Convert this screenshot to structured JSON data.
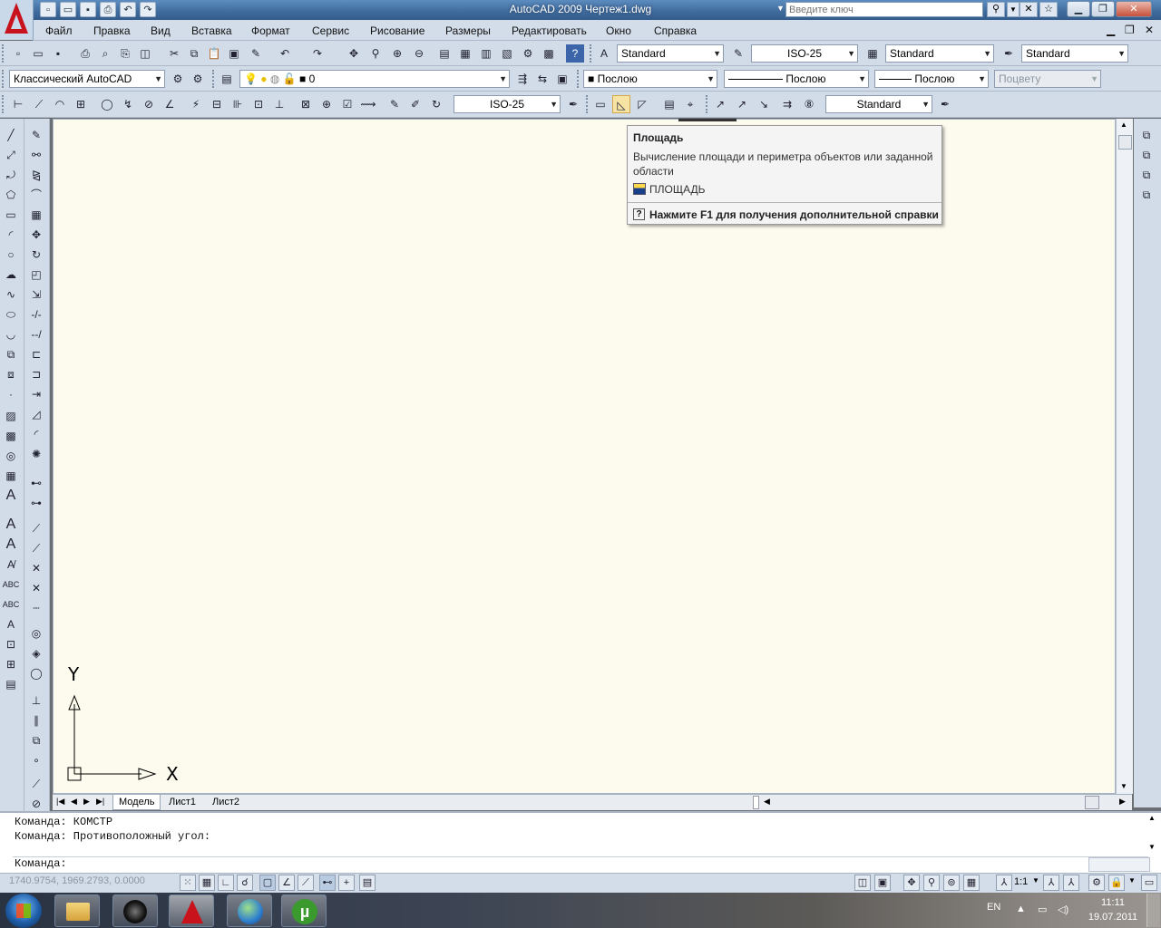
{
  "window": {
    "title": "AutoCAD 2009 Чертеж1.dwg",
    "search_placeholder": "Введите ключ"
  },
  "menu": {
    "items": [
      "Файл",
      "Правка",
      "Вид",
      "Вставка",
      "Формат",
      "Сервис",
      "Рисование",
      "Размеры",
      "Редактировать",
      "Окно",
      "Справка"
    ]
  },
  "toolbars": {
    "text_style": "Standard",
    "dim_style": "ISO-25",
    "table_style": "Standard",
    "mleader_style": "Standard",
    "workspace": "Классический AutoCAD",
    "layer": "0",
    "color": "Послою",
    "linetype": "Послою",
    "lineweight": "Послою",
    "plot_style": "Поцвету",
    "dim_style_2": "ISO-25",
    "mleader_style_2": "Standard"
  },
  "tooltip": {
    "title": "Площадь",
    "description": "Вычисление площади и периметра объектов или заданной области",
    "command": "ПЛОЩАДЬ",
    "help": "Нажмите F1 для получения дополнительной справки"
  },
  "ucs": {
    "x_label": "X",
    "y_label": "Y"
  },
  "tabs": {
    "model": "Модель",
    "layout1": "Лист1",
    "layout2": "Лист2"
  },
  "command": {
    "history": [
      "Команда: КОМСТР",
      "Команда: Противоположный угол:"
    ],
    "prompt": "Команда:"
  },
  "status": {
    "coords": "1740.9754, 1969.2793, 0.0000",
    "annotation_scale": "1:1"
  },
  "taskbar": {
    "lang": "EN",
    "time": "11:11",
    "date": "19.07.2011"
  }
}
